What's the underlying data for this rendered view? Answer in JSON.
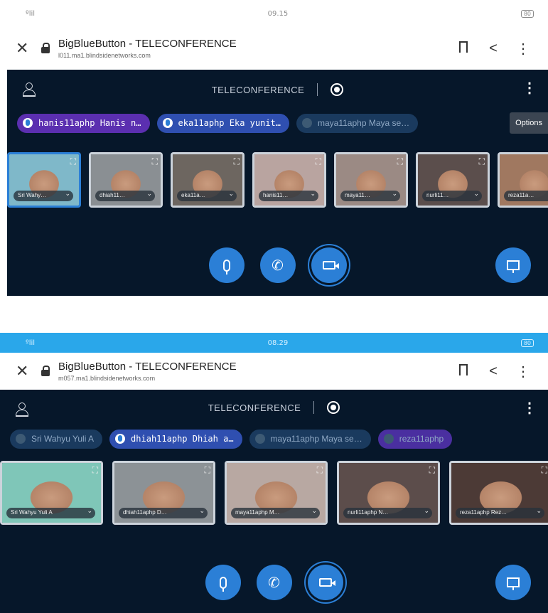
{
  "shots": [
    {
      "status": {
        "signal": "ºlil",
        "time": "09.15",
        "battery": "80"
      },
      "browser": {
        "title": "BigBlueButton - TELECONFERENCE",
        "url": "l011.ma1.blindsidenetworks.com"
      },
      "app": {
        "conference_title": "TELECONFERENCE",
        "options_tooltip": "Options",
        "talkers": [
          {
            "label": "hanis11aphp Hanis n…",
            "color": "#5b2fb0",
            "muted": false
          },
          {
            "label": "eka11aphp Eka yunit…",
            "color": "#2f4fb0",
            "muted": false
          },
          {
            "label": "maya11aphp Maya se…",
            "color": "#1a3a5e",
            "muted": true
          }
        ],
        "videos": [
          {
            "name": "Sri Wahy…",
            "active": true,
            "bg": "#7fb8c9"
          },
          {
            "name": "dhiah11…",
            "active": false,
            "bg": "#8a8f93"
          },
          {
            "name": "eka11a…",
            "active": false,
            "bg": "#6d6660"
          },
          {
            "name": "hanis11…",
            "active": false,
            "bg": "#b9a4a0"
          },
          {
            "name": "maya11…",
            "active": false,
            "bg": "#9b8a84"
          },
          {
            "name": "nurli11…",
            "active": false,
            "bg": "#5b4e4c"
          },
          {
            "name": "reza11a…",
            "active": false,
            "bg": "#a07860"
          }
        ]
      }
    },
    {
      "status": {
        "signal": "ºlil",
        "time": "08.29",
        "battery": "80"
      },
      "browser": {
        "title": "BigBlueButton - TELECONFERENCE",
        "url": "m057.ma1.blindsidenetworks.com"
      },
      "app": {
        "conference_title": "TELECONFERENCE",
        "talkers": [
          {
            "label": "Sri Wahyu Yuli A",
            "color": "#1a3a5e",
            "muted": true
          },
          {
            "label": "dhiah11aphp Dhiah a…",
            "color": "#2f4fb0",
            "muted": false
          },
          {
            "label": "maya11aphp Maya se…",
            "color": "#1a3a5e",
            "muted": true
          },
          {
            "label": "reza11aphp",
            "color": "#4a2fa0",
            "muted": true
          }
        ],
        "videos": [
          {
            "name": "Sri Wahyu Yuli A",
            "active": false,
            "bg": "#7fc6b8"
          },
          {
            "name": "dhiah11aphp D…",
            "active": false,
            "bg": "#8c9296"
          },
          {
            "name": "maya11aphp M…",
            "active": false,
            "bg": "#b8a8a2"
          },
          {
            "name": "nurli11aphp N…",
            "active": false,
            "bg": "#5c4d4b"
          },
          {
            "name": "reza11aphp Rez…",
            "active": false,
            "bg": "#4c3a36"
          }
        ]
      }
    }
  ],
  "icons": {
    "close": "close-icon",
    "lock": "lock-icon",
    "bookmark": "bookmark-icon",
    "share": "share-icon",
    "menu": "kebab-menu-icon",
    "user": "user-list-icon",
    "record": "record-icon",
    "mic": "microphone-icon",
    "phone": "phone-icon",
    "camera": "camera-icon",
    "presentation": "presentation-icon",
    "expand": "fullscreen-icon"
  },
  "colors": {
    "app_bg": "#06172a",
    "accent": "#2b7fd6",
    "statusbar_2": "#2aa7ea"
  }
}
